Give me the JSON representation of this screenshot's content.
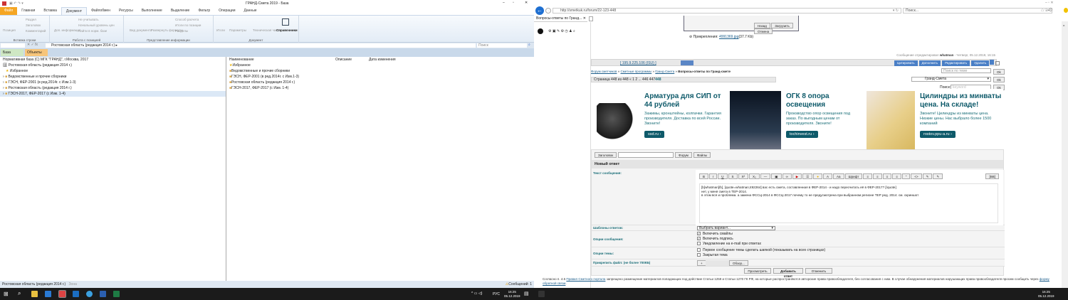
{
  "left": {
    "title": "ГРАНД-Смета 2019 - База",
    "tabs": [
      "Файл",
      "Главная",
      "Вставка",
      "Документ",
      "Файлобмен",
      "Ресурсы",
      "Выполнение",
      "Выделение",
      "Фильтр",
      "Операции",
      "Данные"
    ],
    "ribbon": {
      "insert_group": {
        "label": "Вставка строки",
        "items": [
          "Позиция",
          "Раздел",
          "Заголовок",
          "Комментарий"
        ]
      },
      "position_group": {
        "label": "Работа с позицией",
        "items": [
          "Доп. информация",
          "Не учитывать",
          "Начальный уровень цен",
          "Найти в норм. базе"
        ]
      },
      "view_group": {
        "label": "Представление информации",
        "items": [
          "Вид документа",
          "Развернуть формулы",
          "Способ расчета",
          "Итоги по позиции",
          "Разделы"
        ]
      },
      "document_group": {
        "label": "Документ",
        "items": [
          "Итоги",
          "Параметры",
          "Техническая часть",
          "Справочники"
        ]
      }
    },
    "address": "Ростовская область (редакция 2014 г.)",
    "search_placeholder": "Поиск",
    "buttons": [
      "База",
      "Объекты"
    ],
    "tree_header": "Нормативная база (С) МГК \"ГРАНД\", г.Москва, 2017",
    "tree": [
      "Ростовская область (редакция 2014 г.)",
      "Избранное",
      "Ведомственные и прочие сборники",
      "ГЭСН, ФЕР-2001 (в ред.2014г. с Изм.1-3)",
      "Ростовская область (редакция 2014 г.)",
      "ГЭСН-2017, ФЕР-2017 (с Изм. 1-4)"
    ],
    "columns": [
      "Наименование",
      "Описание",
      "Дата изменения"
    ],
    "list": [
      "Избранное",
      "Ведомственные и прочие сборники",
      "ГЭСН, ФЕР-2001 (в ред.2014г. с Изм.1-3)",
      "Ростовская область (редакция 2014 г.)",
      "ГЭСН-2017, ФЕР-2017 (с Изм. 1-4)"
    ],
    "status": "Ростовская область (редакция 2014 г.)",
    "status_zone": "Зона",
    "messages": "Сообщений: 1"
  },
  "browser": {
    "url": "http://smetkuk.ru/forum/22-123-448",
    "search_placeholder": "Поиск...",
    "tab": "Вопросы-ответы по Гранд..."
  },
  "forum": {
    "dialog_buttons": [
      "Назад",
      "Загрузить",
      "Отмена"
    ],
    "attachment_label": "Прикрепления:",
    "attachment_file": "4991369.jpg",
    "attachment_size": "(37.7 Kb)",
    "edited": "Сообщение отредактировал",
    "edited_user": "whatman",
    "edited_date": "- Четверг, 05.12.2019, 16:15",
    "ip": "[ 195.9.225.106 (ISU) ]",
    "post_buttons": [
      "Цитировать",
      "Дополнить",
      "Редактировать",
      "Удалить"
    ],
    "breadcrumb": [
      "Форум сметчиков",
      "Сметные программы",
      "Гранд-Смета"
    ],
    "breadcrumb_current": "Вопросы-ответы по Гранд-смете",
    "pages": "Страница 448 из 448  «  1  2  ...  446 447",
    "current_page": "448",
    "topic_search_placeholder": "Поиск по теме",
    "ok": "Ok",
    "forum_select": "Гранд-Смета",
    "search_label": "Поиск:",
    "search_placeholder": "keyword",
    "ads": [
      {
        "title": "Арматура для СИП от 44 рублей",
        "text": "Зажимы, кронштейны, колпачки. Гарантия производителя. Доставка по всей России. Звоните!",
        "button": "ssd.ru ›"
      },
      {
        "title": "ОГК 8 опора освещения",
        "text": "Производство опор освещения под заказ. По выгодным ценам от производителя. Звоните!",
        "button": "tochinvest.ru ›"
      },
      {
        "title": "Цилиндры из минваты цена. На складе!",
        "text": "Звоните! Цилиндры из минваты цена. Низкие цены. Нас выбрало более 1500 компаний",
        "button": "rostov.ppu-a.ru ›"
      }
    ],
    "toolbar_buttons": [
      "Заголовок",
      "Форум",
      "Файлы"
    ],
    "new_reply": "Новый ответ",
    "message_label": "Текст сообщения:",
    "font_label": "Шрифт",
    "message_lines": [
      "[b]whatman[/b], [quote=whatman;492264] вас есть смета, составленная в ФЕР-2014 - и надо пересчитать её в ФЕР-2017? [/quote]",
      "нет, у меня смета в ТЕР-2014.",
      "в этом вся и проблема. а замена ФССЦ-2014 в ФССЦ-2017 почему то не предусмотрена при выбранном регионе ТЕР ред. 2014. см. скриншот"
    ],
    "templates_label": "Шаблоны ответов:",
    "templates_select": "Выбрать вариант...",
    "msg_options_label": "Опции сообщения:",
    "msg_options": [
      {
        "label": "Включить смайлы",
        "checked": true
      },
      {
        "label": "Включить подпись",
        "checked": true
      },
      {
        "label": "Уведомление на e-mail при ответах",
        "checked": false
      }
    ],
    "topic_options_label": "Опции темы:",
    "topic_options": [
      {
        "label": "Первое сообщение темы сделать шапкой (показывать на всех страницах)",
        "checked": false
      },
      {
        "label": "Закрытая тема",
        "checked": false
      }
    ],
    "attach_label": "Прикрепить файл: (не более 700КБ)",
    "browse": "Обзор...",
    "plus": "+",
    "actions": [
      "Просмотреть",
      "Добавить ответ",
      "Отменить"
    ],
    "notice_pre": "Согласно п. 4.5",
    "notice_link": "Правил Сметного портала",
    "notice_text": "запрещено размещение материалов попадающих под действие Статьи 1259 и Статьи 1270 ГК РФ, на которые распространяются авторские права правообладателя, без согласования с ним. В случае обнаружения материалов нарушающих права правообладателя просим сообщить через",
    "notice_link2": "форму обратной связи"
  },
  "taskbar": {
    "lang": "РУС",
    "time": "16:25",
    "date": "05.12.2019"
  }
}
